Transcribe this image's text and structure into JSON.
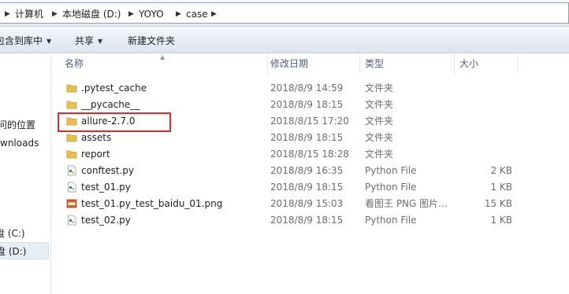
{
  "breadcrumb": {
    "items": [
      "计算机",
      "本地磁盘 (D:)",
      "YOYO",
      "case"
    ]
  },
  "toolbar": {
    "include_label": "包含到库中",
    "share_label": "共享",
    "new_folder_label": "新建文件夹"
  },
  "nav": {
    "items": [
      "问的位置",
      "wnloads",
      "盘 (C:)",
      "盘 (D:)"
    ]
  },
  "columns": {
    "name": "名称",
    "modified": "修改日期",
    "type": "类型",
    "size": "大小"
  },
  "files": [
    {
      "name": ".pytest_cache",
      "date": "2018/8/9 14:59",
      "type": "文件夹",
      "size": "",
      "icon": "folder-icon"
    },
    {
      "name": "__pycache__",
      "date": "2018/8/9 18:15",
      "type": "文件夹",
      "size": "",
      "icon": "folder-icon"
    },
    {
      "name": "allure-2.7.0",
      "date": "2018/8/15 17:20",
      "type": "文件夹",
      "size": "",
      "icon": "folder-icon"
    },
    {
      "name": "assets",
      "date": "2018/8/9 18:15",
      "type": "文件夹",
      "size": "",
      "icon": "folder-icon"
    },
    {
      "name": "report",
      "date": "2018/8/15 18:28",
      "type": "文件夹",
      "size": "",
      "icon": "folder-icon"
    },
    {
      "name": "conftest.py",
      "date": "2018/8/9 16:35",
      "type": "Python File",
      "size": "2 KB",
      "icon": "python-file-icon"
    },
    {
      "name": "test_01.py",
      "date": "2018/8/9 18:15",
      "type": "Python File",
      "size": "1 KB",
      "icon": "python-file-icon"
    },
    {
      "name": "test_01.py_test_baidu_01.png",
      "date": "2018/8/9 15:03",
      "type": "看图王 PNG 图片...",
      "size": "15 KB",
      "icon": "png-file-icon"
    },
    {
      "name": "test_02.py",
      "date": "2018/8/9 18:15",
      "type": "Python File",
      "size": "1 KB",
      "icon": "python-file-icon"
    }
  ],
  "colors": {
    "folder": "#e8c04f",
    "highlight_box": "#e0282e",
    "png_badge": "#d9642a",
    "header_text": "#4c607a"
  }
}
